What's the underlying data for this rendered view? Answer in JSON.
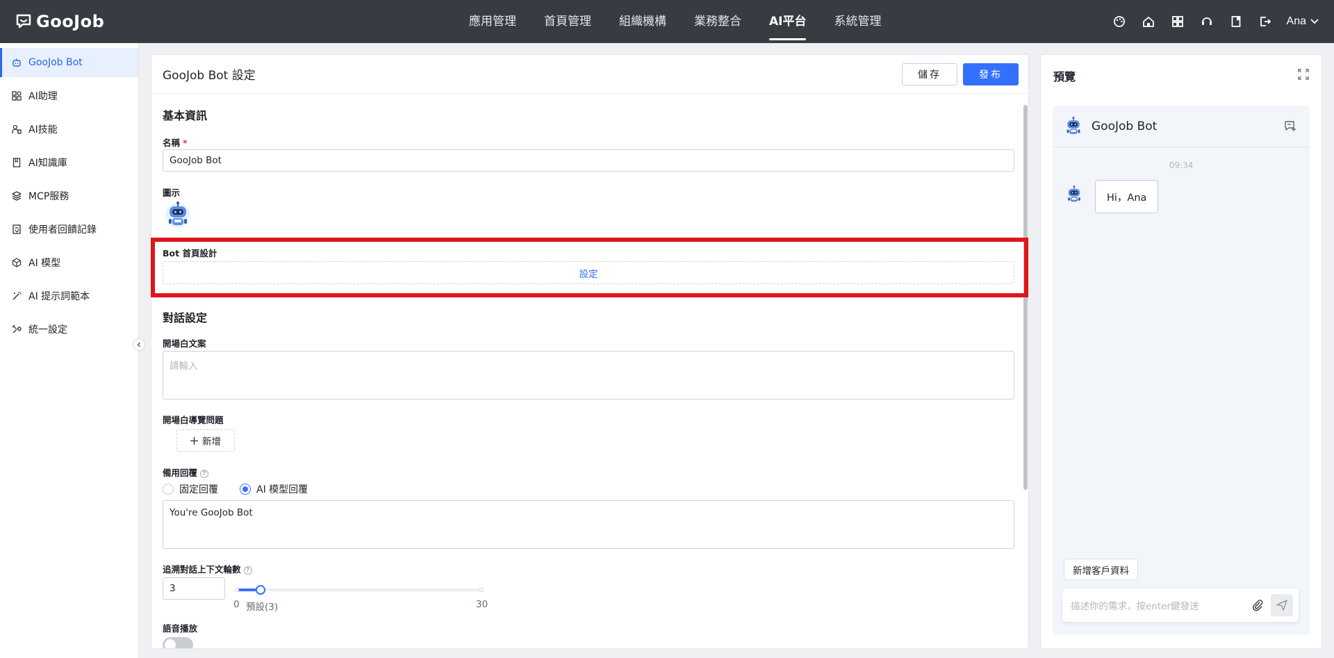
{
  "brand": {
    "logo_text": "GooJob"
  },
  "nav": [
    "應用管理",
    "首頁管理",
    "組織機構",
    "業務整合",
    "AI平台",
    "系統管理"
  ],
  "user": {
    "name": "Ana"
  },
  "sidebar": {
    "items": [
      {
        "label": "GooJob Bot",
        "icon": "bot-icon",
        "active": true
      },
      {
        "label": "AI助理",
        "icon": "grid-icon"
      },
      {
        "label": "AI技能",
        "icon": "skill-icon"
      },
      {
        "label": "AI知識庫",
        "icon": "book-icon"
      },
      {
        "label": "MCP服務",
        "icon": "layers-icon"
      },
      {
        "label": "使用者回饋記錄",
        "icon": "feedback-icon"
      },
      {
        "label": "AI 模型",
        "icon": "cube-icon"
      },
      {
        "label": "AI 提示詞範本",
        "icon": "wand-icon"
      },
      {
        "label": "統一設定",
        "icon": "settings-icon"
      }
    ]
  },
  "main": {
    "title": "GooJob Bot 設定",
    "save_label": "儲存",
    "publish_label": "發布",
    "basic_section": "基本資訊",
    "name_label": "名稱",
    "name_required": "*",
    "name_value": "GooJob Bot",
    "icon_label": "圖示",
    "home_design_label": "Bot 首頁設計",
    "home_design_button": "設定",
    "dialog_section": "對話設定",
    "opening_label": "開場白文案",
    "opening_placeholder": "請輸入",
    "opening_questions_label": "開場白導覽問題",
    "add_label": "新增",
    "fallback_label": "備用回覆",
    "fallback_options": [
      "固定回覆",
      "AI 模型回覆"
    ],
    "fallback_selected": "AI 模型回覆",
    "fallback_text": "You're GooJob Bot",
    "context_label": "追溯對話上下文輪數",
    "context_value": "3",
    "slider": {
      "min": 0,
      "max": 30,
      "value": 3,
      "min_label": "0",
      "default_label": "預設(3)",
      "max_label": "30"
    },
    "voice_label": "語音播放",
    "voice_on": false
  },
  "preview": {
    "title": "預覽",
    "bot_name": "GooJob Bot",
    "time": "09:34",
    "greeting": "Hi，Ana",
    "quick_action": "新增客戶資料",
    "input_placeholder": "描述你的需求，按enter鍵發送"
  },
  "colors": {
    "accent": "#3370ff",
    "topbar": "#373b42",
    "highlight": "#e0151b"
  }
}
